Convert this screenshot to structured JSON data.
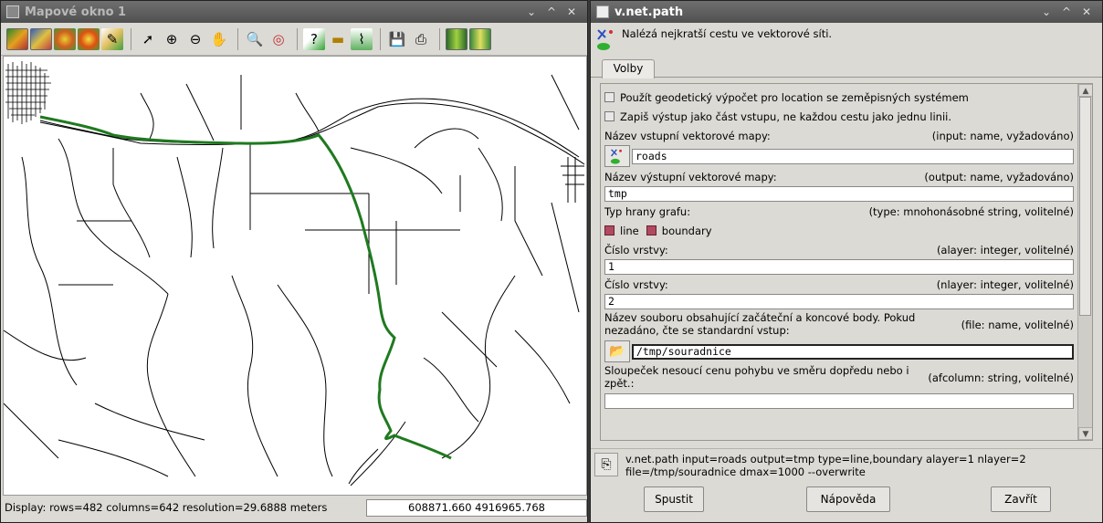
{
  "map_window": {
    "title": "Mapové okno 1",
    "status_text": "Display: rows=482 columns=642  resolution=29.6888 meters",
    "coordinates": "608871.660 4916965.768"
  },
  "dialog": {
    "title": "v.net.path",
    "description": "Nalézá nejkratší cestu ve vektorové síti.",
    "tab_label": "Volby",
    "options": {
      "geodetic": "Použít geodetický výpočet pro location se zeměpisných systémem",
      "write_as_part": "Zapiš výstup jako část vstupu, ne každou cestu jako jednu linii.",
      "input_label": "Název vstupní vektorové mapy:",
      "input_meta": "(input:  name, vyžadováno)",
      "input_value": "roads",
      "output_label": "Název výstupní vektorové mapy:",
      "output_meta": "(output:  name, vyžadováno)",
      "output_value": "tmp",
      "type_label": "Typ hrany grafu:",
      "type_meta": "(type:  mnohonásobné string, volitelné)",
      "type_line": "line",
      "type_boundary": "boundary",
      "alayer_label": "Číslo vrstvy:",
      "alayer_meta": "(alayer:  integer, volitelné)",
      "alayer_value": "1",
      "nlayer_label": "Číslo vrstvy:",
      "nlayer_meta": "(nlayer:  integer, volitelné)",
      "nlayer_value": "2",
      "file_label": "Název souboru obsahující začáteční a koncové body. Pokud nezadáno, čte se standardní vstup:",
      "file_meta": "(file:  name, volitelné)",
      "file_value": "/tmp/souradnice",
      "afcolumn_label": "Sloupeček nesoucí cenu pohybu ve směru dopředu nebo i zpět.:",
      "afcolumn_meta": "(afcolumn:  string, volitelné)",
      "afcolumn_value": ""
    },
    "command_text": "v.net.path input=roads output=tmp type=line,boundary alayer=1 nlayer=2 file=/tmp/souradnice dmax=1000 --overwrite",
    "buttons": {
      "run": "Spustit",
      "help": "Nápověda",
      "close": "Zavřít"
    }
  },
  "titlebar_buttons": {
    "menu": "⌄",
    "minimize": "^",
    "close": "✕"
  },
  "icons": {
    "toolbar": [
      "display-map-icon",
      "display-overlay-icon",
      "raster-icon",
      "vector-icon",
      "erase-icon",
      "pointer-icon",
      "zoom-in-icon",
      "zoom-out-icon",
      "pan-icon",
      "zoom-back-icon",
      "zoom-menu-icon",
      "query-icon",
      "measure-icon",
      "profile-icon",
      "save-icon",
      "print-icon",
      "nviz-icon",
      "histogram-icon"
    ]
  },
  "colors": {
    "route": "#1f7a1f",
    "road": "#000000",
    "checkbox_checked": "#b04a60"
  }
}
